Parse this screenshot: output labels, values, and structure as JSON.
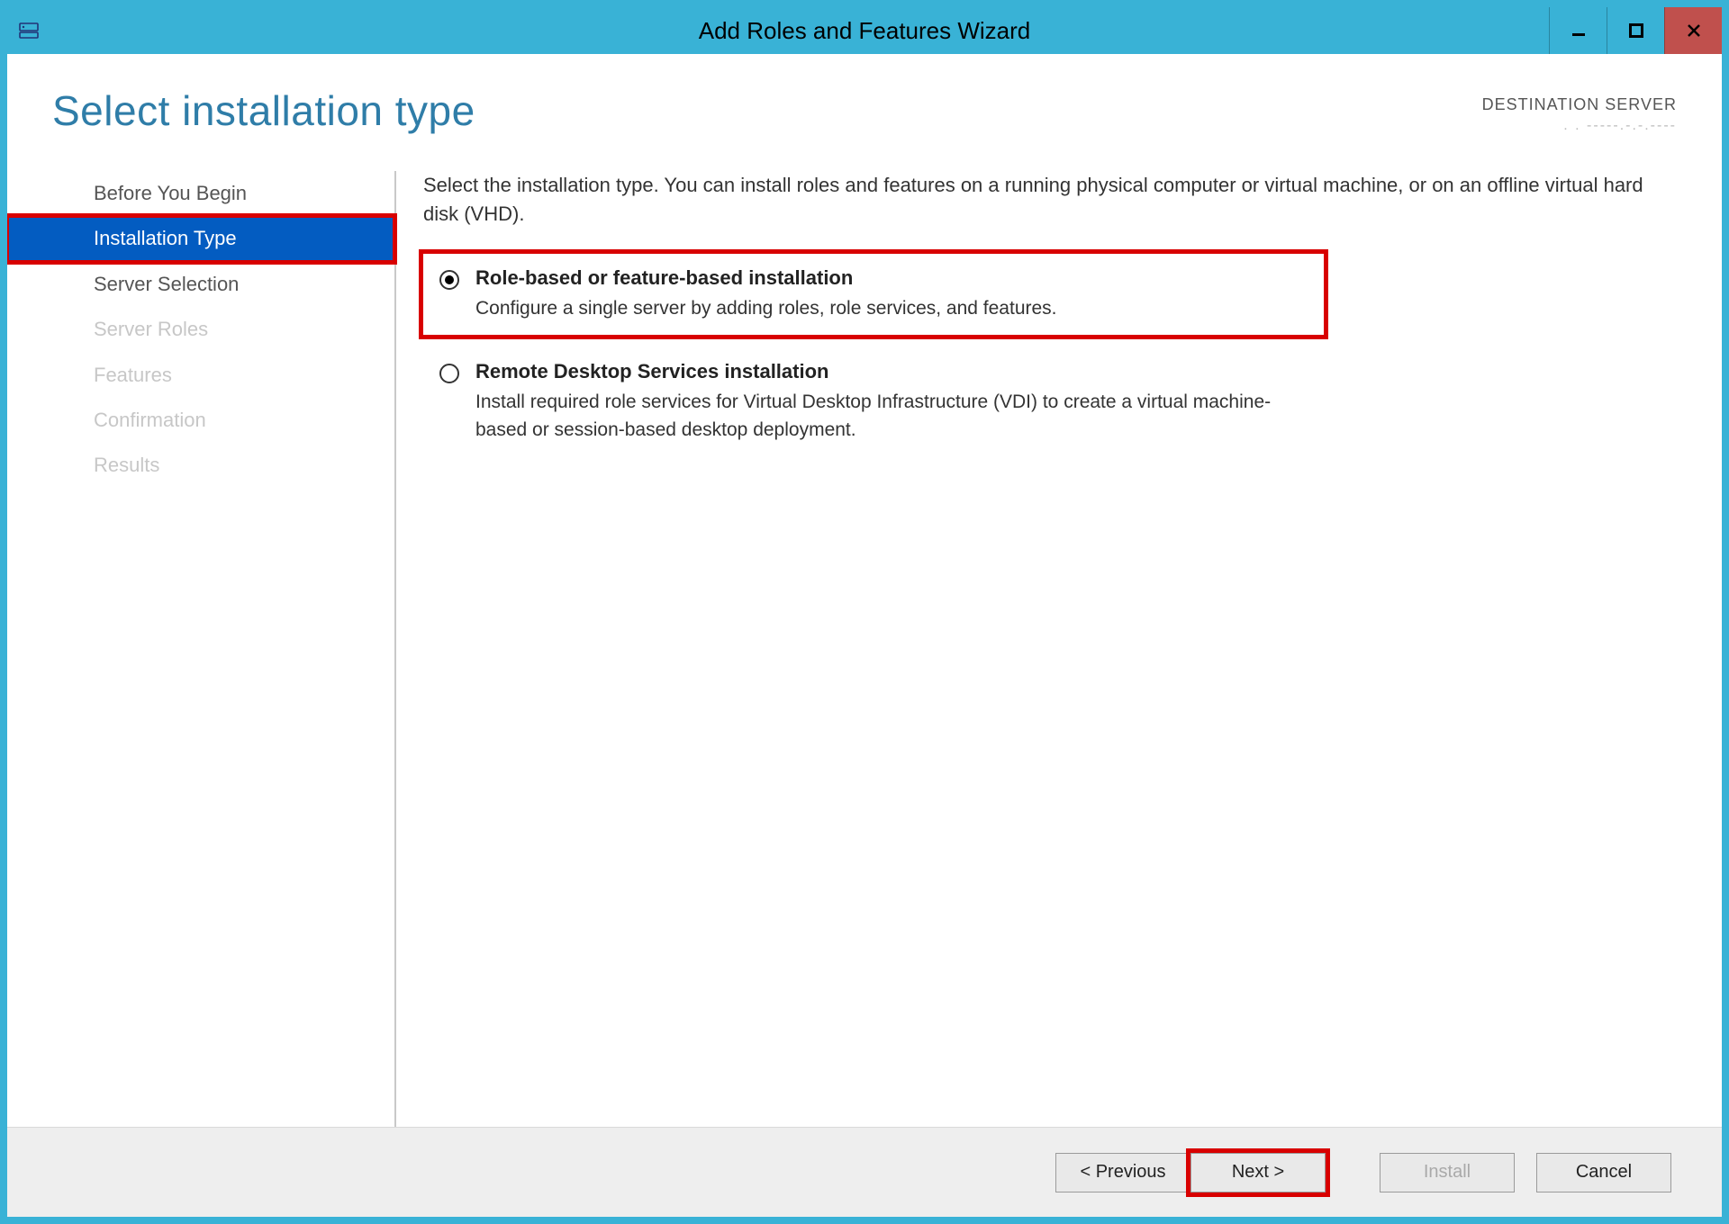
{
  "window": {
    "title": "Add Roles and Features Wizard"
  },
  "header": {
    "heading": "Select installation type",
    "destination_label": "DESTINATION SERVER",
    "destination_value": ". .  -----.-.-.----"
  },
  "sidebar": {
    "steps": [
      {
        "label": "Before You Begin",
        "state": "enabled"
      },
      {
        "label": "Installation Type",
        "state": "active"
      },
      {
        "label": "Server Selection",
        "state": "enabled"
      },
      {
        "label": "Server Roles",
        "state": "disabled"
      },
      {
        "label": "Features",
        "state": "disabled"
      },
      {
        "label": "Confirmation",
        "state": "disabled"
      },
      {
        "label": "Results",
        "state": "disabled"
      }
    ]
  },
  "content": {
    "intro": "Select the installation type. You can install roles and features on a running physical computer or virtual machine, or on an offline virtual hard disk (VHD).",
    "options": [
      {
        "title": "Role-based or feature-based installation",
        "description": "Configure a single server by adding roles, role services, and features.",
        "selected": true,
        "highlighted": true
      },
      {
        "title": "Remote Desktop Services installation",
        "description": "Install required role services for Virtual Desktop Infrastructure (VDI) to create a virtual machine-based or session-based desktop deployment.",
        "selected": false,
        "highlighted": false
      }
    ]
  },
  "footer": {
    "previous": "< Previous",
    "next": "Next >",
    "install": "Install",
    "cancel": "Cancel"
  },
  "highlights": {
    "sidebar_step_highlighted_index": 1,
    "next_button_highlighted": true
  }
}
